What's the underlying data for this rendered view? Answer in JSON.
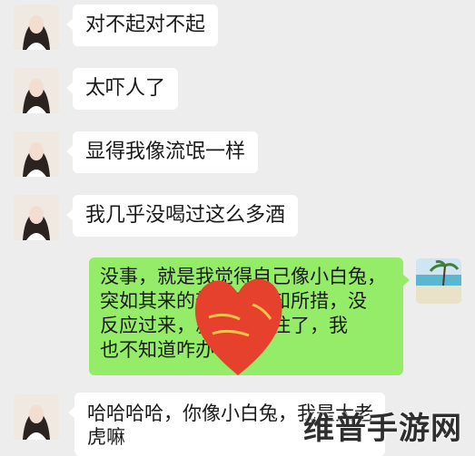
{
  "messages": [
    {
      "side": "left",
      "text": "对不起对不起"
    },
    {
      "side": "left",
      "text": "太吓人了"
    },
    {
      "side": "left",
      "text": "显得我像流氓一样"
    },
    {
      "side": "left",
      "text": "我几乎没喝过这么多酒"
    },
    {
      "side": "right",
      "lines": [
        "没事，就是我觉得自己像小白兔，",
        "突如其来的架势我不知所措，没",
        "反应过来，就已经含住了，我",
        "也不知道咋办"
      ]
    },
    {
      "side": "left",
      "lines": [
        "哈哈哈哈，你像小白兔，我是大老",
        "虎嘛"
      ]
    }
  ],
  "watermark": "维普手游网",
  "colors": {
    "background": "#ededed",
    "incoming_bubble": "#ffffff",
    "outgoing_bubble": "#95ec69",
    "heart": "#e5412d"
  }
}
